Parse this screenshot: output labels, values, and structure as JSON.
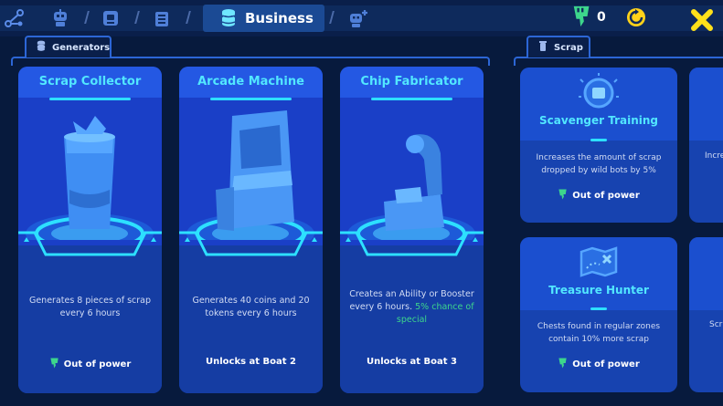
{
  "topbar": {
    "active_tab_label": "Business",
    "power_count": "0",
    "icons": [
      "network-icon",
      "robot-icon",
      "bot-card-icon",
      "clipboard-icon",
      "coin-stack-icon",
      "robot-add-icon",
      "power-plug-icon",
      "refresh-icon",
      "close-icon"
    ]
  },
  "sections": {
    "generators_label": "Generators",
    "scrap_label": "Scrap"
  },
  "generators": [
    {
      "title": "Scrap Collector",
      "description": "Generates 8 pieces of scrap every 6 hours",
      "status": "Out of power",
      "status_type": "power"
    },
    {
      "title": "Arcade Machine",
      "description": "Generates 40 coins and 20 tokens every 6 hours",
      "status": "Unlocks at Boat 2",
      "status_type": "locked"
    },
    {
      "title": "Chip Fabricator",
      "description_main": "Creates an Ability or Booster every 6 hours.",
      "description_highlight": "5% chance of special",
      "status": "Unlocks at Boat 3",
      "status_type": "locked"
    }
  ],
  "scrap_upgrades": [
    {
      "title": "Scavenger Training",
      "description": "Increases the amount of scrap dropped by wild bots by 5%",
      "status": "Out of power"
    },
    {
      "title": "Treasure Hunter",
      "description": "Chests found in regular zones contain 10% more scrap",
      "status": "Out of power"
    }
  ],
  "partial_cards": {
    "top_text": "Incre",
    "bottom_text": "Scr"
  },
  "colors": {
    "background": "#071a3d",
    "card": "#1a3fc7",
    "title": "#52e7ff",
    "accent": "#2de0ff",
    "power_green": "#3dd68c",
    "close_yellow": "#ffe11a"
  }
}
